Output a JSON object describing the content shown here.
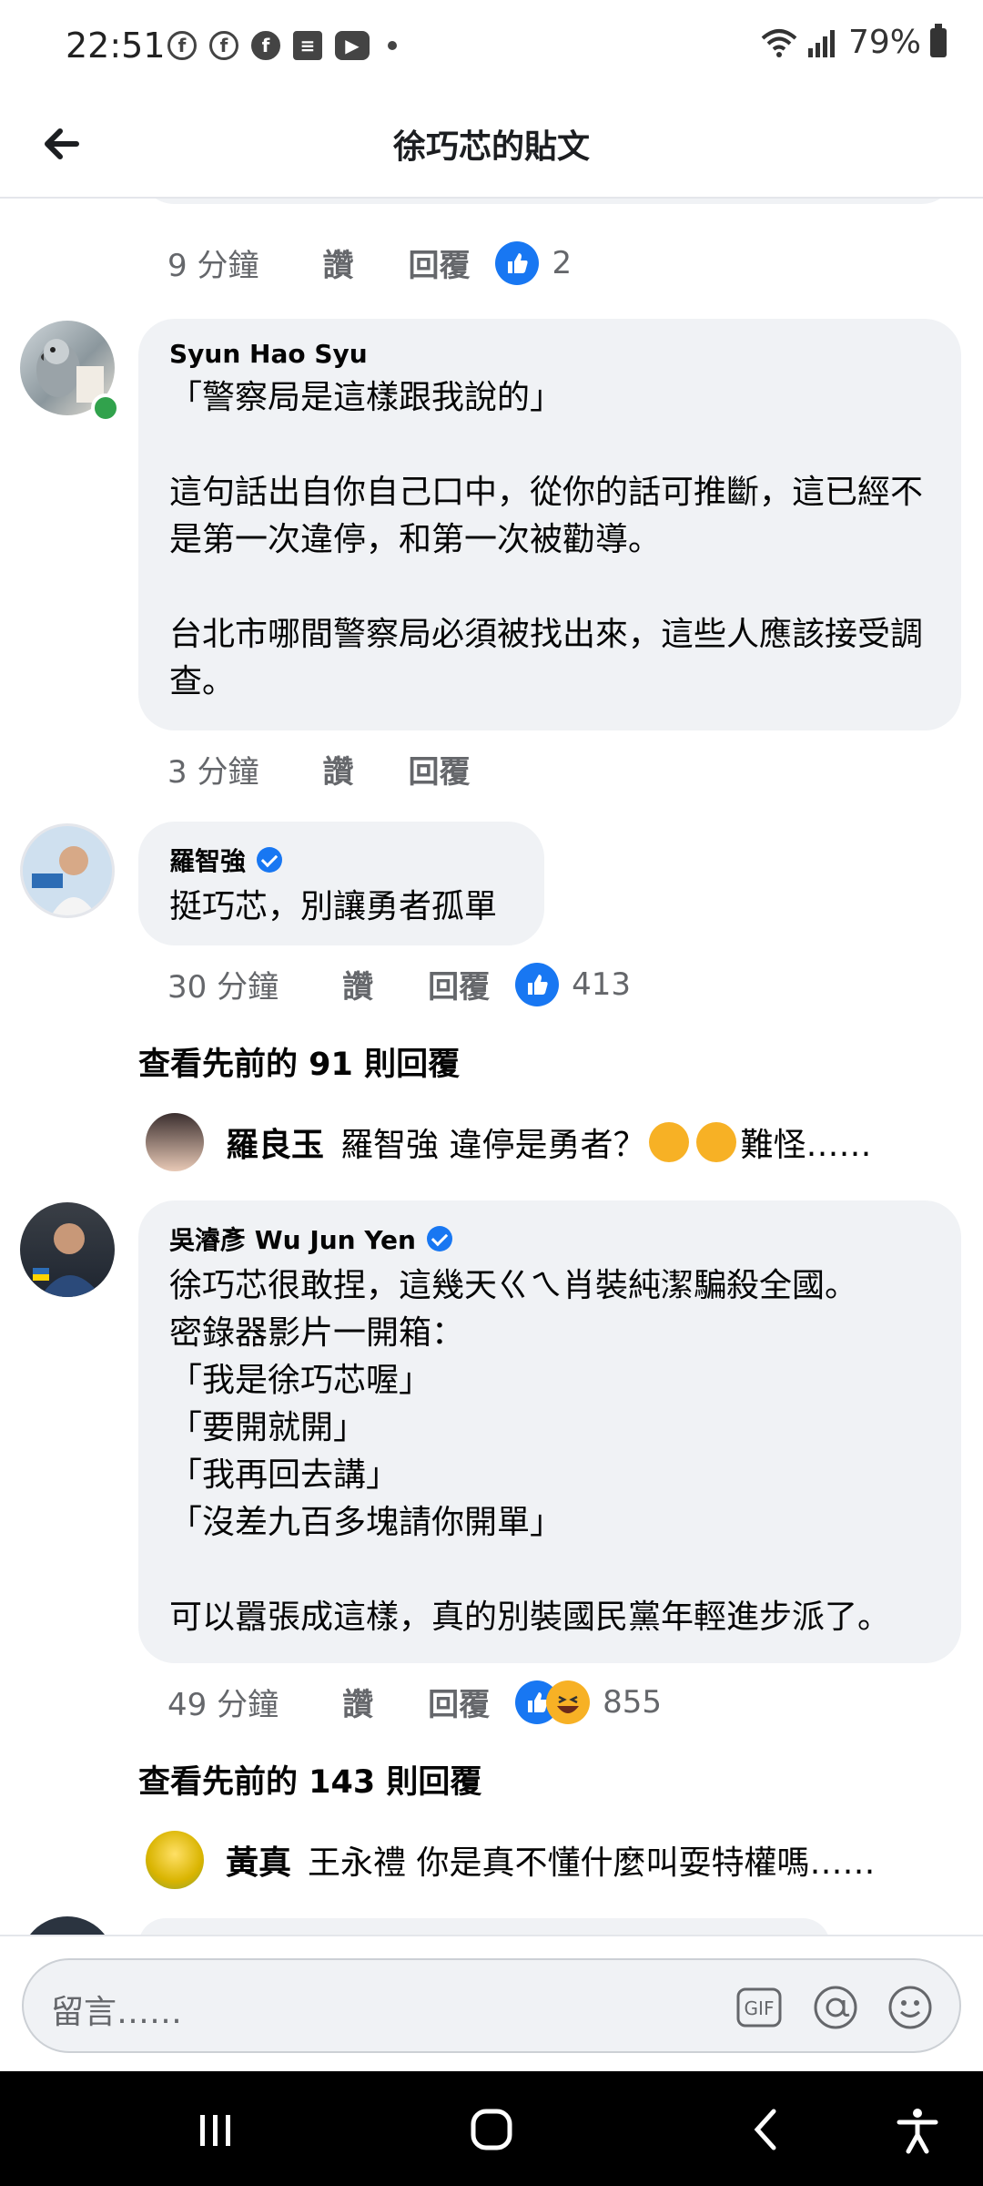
{
  "status_bar": {
    "time": "22:51",
    "battery": "79%",
    "app_icons": [
      "facebook-icon",
      "facebook-icon",
      "facebook-icon",
      "news-icon",
      "youtube-icon"
    ]
  },
  "header": {
    "title": "徐巧芯的貼文"
  },
  "prev_comment_meta": {
    "time": "9 分鐘",
    "like": "讚",
    "reply": "回覆",
    "reaction_count": "2"
  },
  "comments": [
    {
      "name": "Syun Hao Syu",
      "text": "「警察局是這樣跟我說的」\n\n這句話出自你自己口中，從你的話可推斷，這已經不是第一次違停，和第一次被勸導。\n\n台北市哪間警察局必須被找出來，這些人應該接受調查。",
      "time": "3 分鐘",
      "like": "讚",
      "reply": "回覆"
    },
    {
      "name": "羅智強",
      "text": "挺巧芯，別讓勇者孤單",
      "time": "30 分鐘",
      "like": "讚",
      "reply": "回覆",
      "reaction_count": "413",
      "view_more": "查看先前的 91 則回覆",
      "preview": {
        "name": "羅良玉",
        "text_before": "羅智強 違停是勇者？",
        "text_after": "難怪……"
      }
    },
    {
      "name": "吳濬彥 Wu Jun Yen",
      "text": "徐巧芯很敢捏，這幾天ㄍㄟ肖裝純潔騙殺全國。\n密錄器影片一開箱：\n「我是徐巧芯喔」\n「要開就開」\n「我再回去講」\n「沒差九百多塊請你開單」\n\n可以囂張成這樣，真的別裝國民黨年輕進步派了。",
      "time": "49 分鐘",
      "like": "讚",
      "reply": "回覆",
      "reaction_count": "855",
      "view_more": "查看先前的 143 則回覆",
      "preview": {
        "name": "黃真",
        "text": "王永禮 你是真不懂什麼叫耍特權嗎……"
      }
    }
  ],
  "composer": {
    "placeholder": "留言……",
    "gif_label": "GIF"
  },
  "colors": {
    "accent": "#1877f2",
    "bubble": "#f0f2f5",
    "meta": "#65676b",
    "online": "#31a24c"
  }
}
